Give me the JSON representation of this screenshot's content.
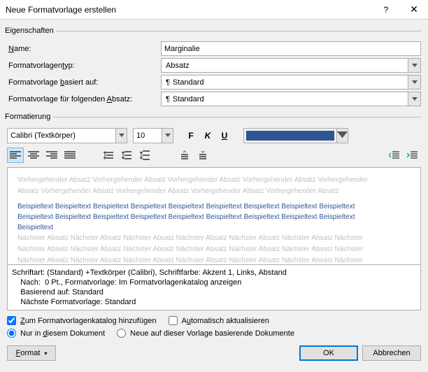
{
  "title": "Neue Formatvorlage erstellen",
  "sections": {
    "eigenschaften": "Eigenschaften",
    "formatierung": "Formatierung"
  },
  "labels": {
    "name": "Name:",
    "name_u": "N",
    "typ": "Formatvorlagentyp:",
    "typ_u": "t",
    "basiert": "Formatvorlage basiert auf:",
    "basiert_u": "b",
    "folgende": "Formatvorlage für folgenden Absatz:",
    "folgende_u": "A"
  },
  "values": {
    "name": "Marginalie",
    "typ": "Absatz",
    "basiert": "Standard",
    "folgende": "Standard"
  },
  "format": {
    "font": "Calibri (Textkörper)",
    "size": "10",
    "bold": "F",
    "italic": "K",
    "underline": "U",
    "color": "#2f5496"
  },
  "preview": {
    "before": "Vorhergehender Absatz Vorhergehender Absatz Vorhergehender Absatz Vorhergehender Absatz Vorhergehender",
    "before2": "Absatz Vorhergehender Absatz Vorhergehender Absatz Vorhergehender Absatz Vorhergehender Absatz",
    "sample": "Beispieltext Beispieltext Beispieltext Beispieltext Beispieltext Beispieltext Beispieltext Beispieltext Beispieltext",
    "sample3": "Beispieltext",
    "after": "Nächster Absatz Nächster Absatz Nächster Absatz Nächster Absatz Nächster Absatz Nächster Absatz Nächster"
  },
  "description": {
    "l1": "Schriftart: (Standard) +Textkörper (Calibri), Schriftfarbe: Akzent 1, Links, Abstand",
    "l2": "    Nach:  0 Pt., Formatvorlage: Im Formatvorlagenkatalog anzeigen",
    "l3": "    Basierend auf: Standard",
    "l4": "    Nächste Formatvorlage: Standard"
  },
  "options": {
    "addcatalog": "Zum Formatvorlagenkatalog hinzufügen",
    "addcatalog_u": "Z",
    "autoupdate": "Automatisch aktualisieren",
    "autoupdate_u": "u",
    "onlydoc": "Nur in diesem Dokument",
    "onlydoc_u": "d",
    "templatebased": "Neue auf dieser Vorlage basierende Dokumente"
  },
  "buttons": {
    "format": "Format",
    "format_u": "F",
    "ok": "OK",
    "cancel": "Abbrechen"
  }
}
